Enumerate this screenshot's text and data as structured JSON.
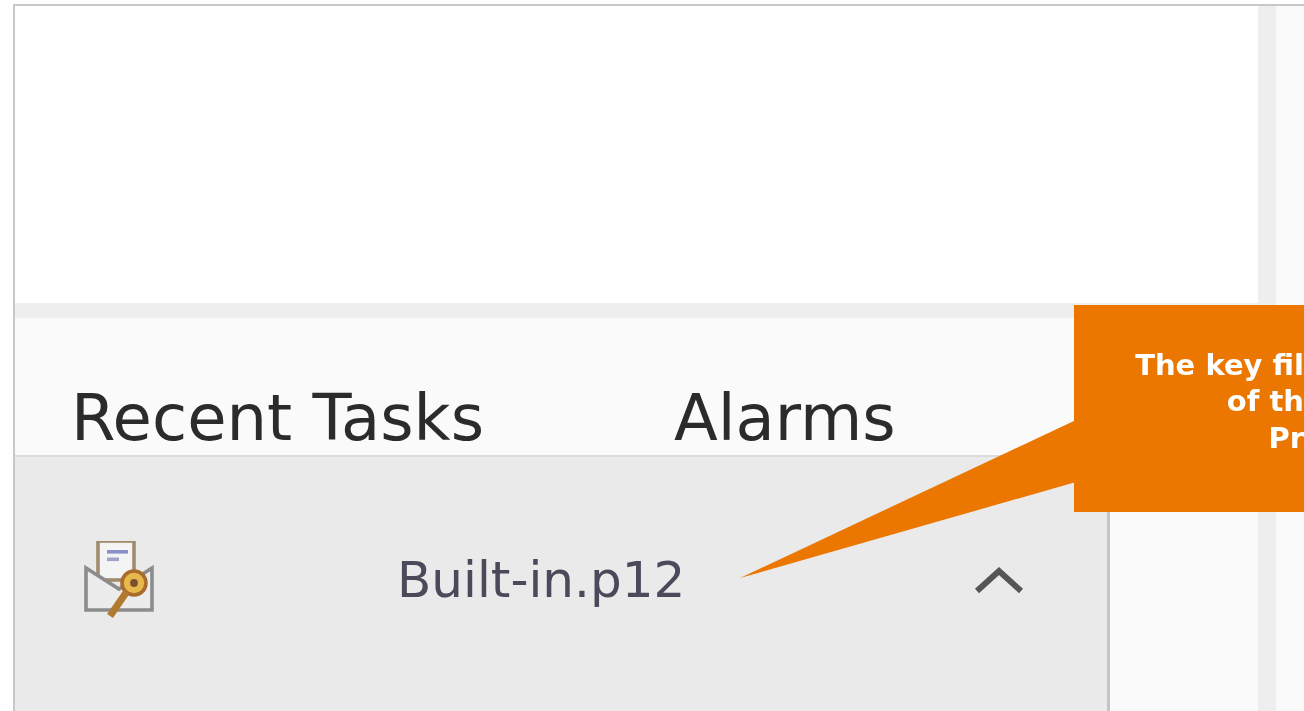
{
  "panel_tabs": [
    {
      "label": "Recent Tasks"
    },
    {
      "label": "Alarms"
    }
  ],
  "download_bar": {
    "file_name": "Built-in.p12"
  },
  "callout": {
    "lines": [
      "The key fil",
      "of th",
      "Pr"
    ]
  }
}
